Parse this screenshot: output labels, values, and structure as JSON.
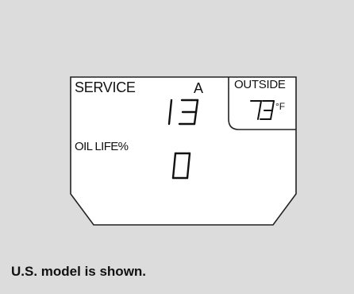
{
  "display": {
    "service_label": "SERVICE",
    "maintenance_code": "A",
    "days_remaining": "13",
    "outside_label": "OUTSIDE",
    "temperature": "73",
    "temperature_unit": "°F",
    "oil_life_label": "OIL LIFE%",
    "oil_life_value": "0"
  },
  "caption": "U.S. model is shown.",
  "colors": {
    "background": "#dcdcdc",
    "display_fill": "#ffffff",
    "outline": "#222222"
  }
}
